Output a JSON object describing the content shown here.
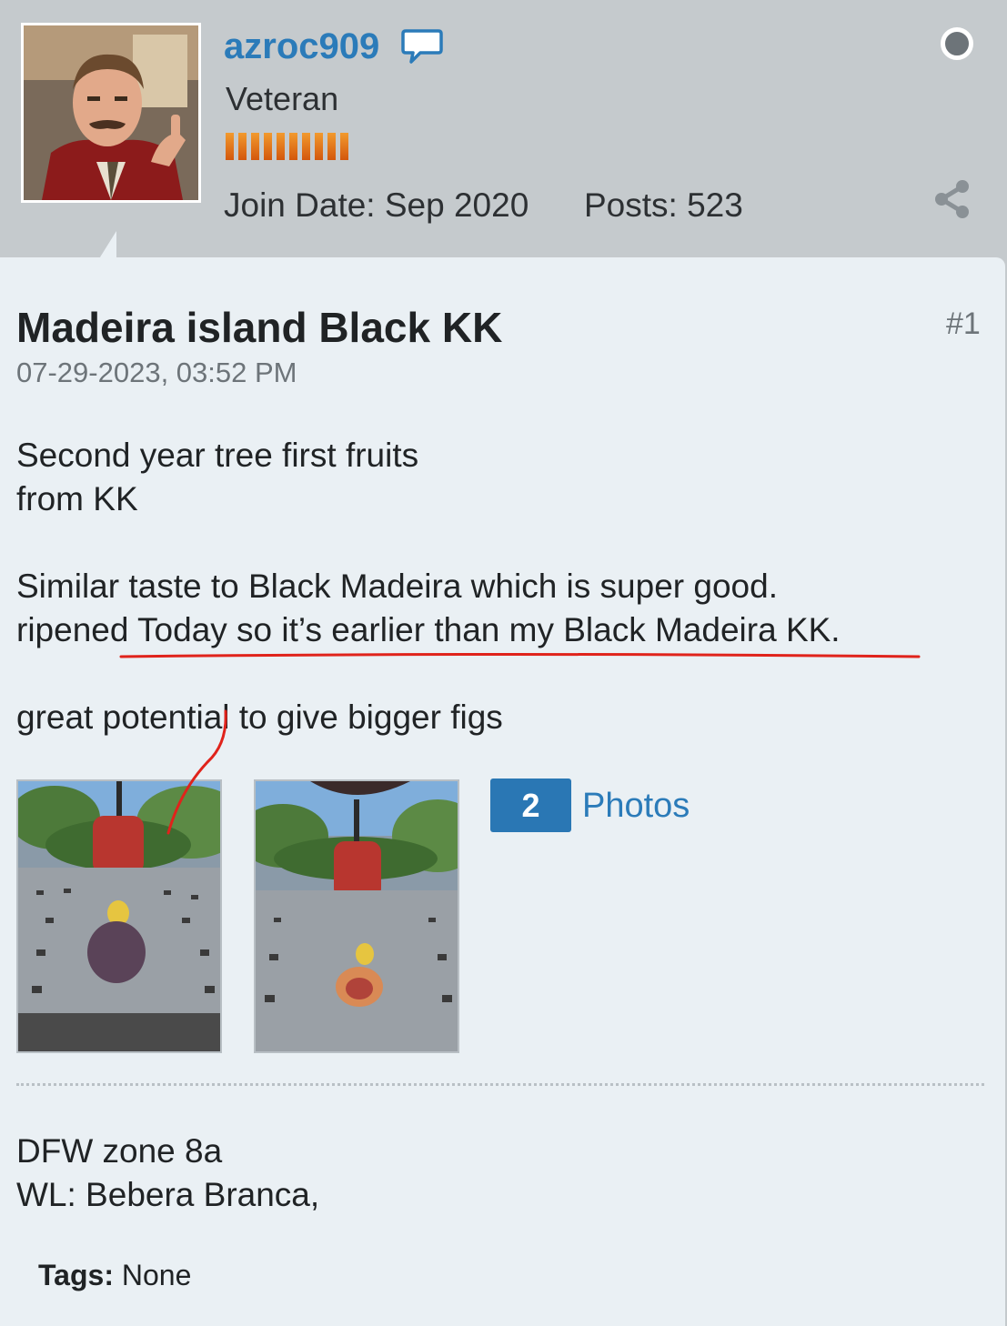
{
  "user": {
    "name": "azroc909",
    "rank": "Veteran",
    "reputation_pips": 10,
    "join_date": "Join Date: Sep 2020",
    "posts": "Posts: 523"
  },
  "post": {
    "title": "Madeira island Black KK",
    "number": "#1",
    "date": "07-29-2023, 03:52 PM",
    "lines": {
      "l1": "Second year tree first fruits",
      "l2": "from KK",
      "l3": "Similar taste to Black Madeira which is super good.",
      "l4": "ripened Today so it’s earlier than my Black Madeira KK.",
      "l5": "great potential to give bigger figs"
    },
    "photos": {
      "count": "2",
      "label": "Photos"
    },
    "signature": {
      "s1": "DFW zone 8a",
      "s2": "WL: Bebera Branca,"
    },
    "tags": {
      "label": "Tags:",
      "value": "None"
    }
  },
  "colors": {
    "header_bg": "#c5cacd",
    "card_bg": "#eaf0f4",
    "link": "#2b7bb9",
    "badge": "#2a77b4",
    "annotation": "#e0231b"
  },
  "icons": [
    "chat-bubble-icon",
    "status-dot-icon",
    "share-icon"
  ]
}
